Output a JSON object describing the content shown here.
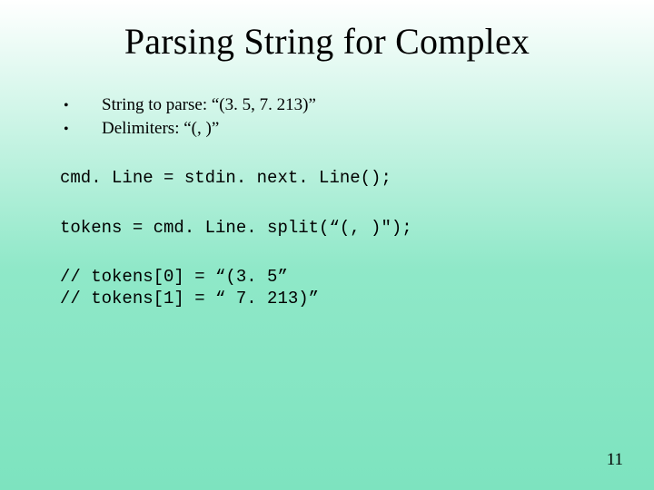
{
  "title": "Parsing String for Complex",
  "bullets": [
    {
      "label": "String to parse: ",
      "value": "“(3. 5, 7. 213)”"
    },
    {
      "label": "Delimiters: ",
      "value": "“(, )”"
    }
  ],
  "code": {
    "line1": "cmd. Line = stdin. next. Line();",
    "line2": "tokens = cmd. Line. split(“(, )\");",
    "line3": "// tokens[0] = “(3. 5”",
    "line4": "// tokens[1] = “ 7. 213)”"
  },
  "page_number": "11"
}
